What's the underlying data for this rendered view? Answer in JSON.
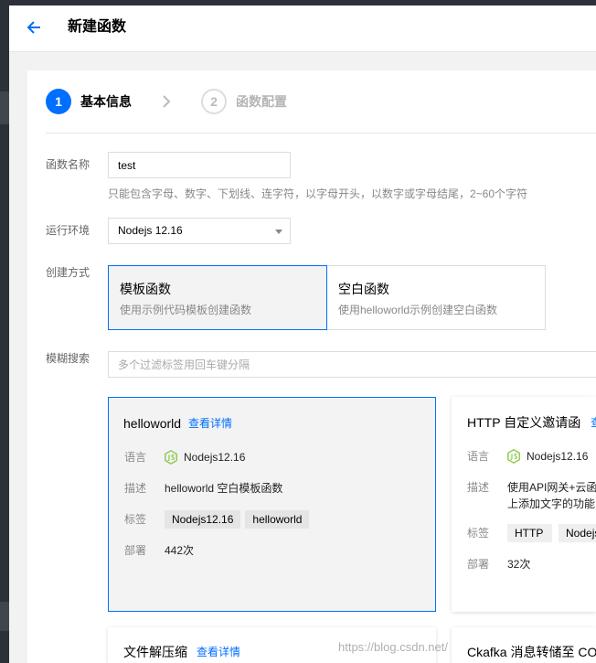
{
  "header": {
    "title": "新建函数"
  },
  "icons": {
    "back": "arrow-left-icon",
    "step_separator": "chevron-right-icon",
    "select_caret": "caret-down-icon",
    "language": "nodejs-icon"
  },
  "colors": {
    "accent": "#006eff",
    "nodejs_green": "#8cc84b",
    "sidebar": "#2c3038"
  },
  "steps": [
    {
      "number": "1",
      "label": "基本信息",
      "active": true
    },
    {
      "number": "2",
      "label": "函数配置",
      "active": false
    }
  ],
  "form": {
    "name": {
      "label": "函数名称",
      "value": "test",
      "help": "只能包含字母、数字、下划线、连字符，以字母开头，以数字或字母结尾，2~60个字符"
    },
    "runtime": {
      "label": "运行环境",
      "value": "Nodejs 12.16"
    },
    "create_mode": {
      "label": "创建方式",
      "options": [
        {
          "title": "模板函数",
          "desc": "使用示例代码模板创建函数",
          "selected": true
        },
        {
          "title": "空白函数",
          "desc": "使用helloworld示例创建空白函数",
          "selected": false
        }
      ]
    },
    "search": {
      "label": "模糊搜索",
      "placeholder": "多个过滤标签用回车键分隔"
    }
  },
  "templates": {
    "field_labels": {
      "language": "语言",
      "description": "描述",
      "tags": "标签",
      "deploys": "部署"
    },
    "cards": [
      {
        "title": "helloworld",
        "detail_link": "查看详情",
        "language": "Nodejs12.16",
        "description_lines": [
          "helloworld 空白模板函数"
        ],
        "tags": [
          "Nodejs12.16",
          "helloworld"
        ],
        "deploys": "442次",
        "selected": true
      },
      {
        "title": "HTTP 自定义邀请函",
        "detail_link": "查",
        "language": "Nodejs12.16",
        "description_lines": [
          "使用API网关+云函",
          "上添加文字的功能"
        ],
        "tags": [
          "HTTP",
          "Nodejs"
        ],
        "deploys": "32次",
        "selected": false
      },
      {
        "title": "文件解压缩",
        "detail_link": "查看详情"
      },
      {
        "title": "Ckafka 消息转储至 CO"
      }
    ]
  },
  "watermark": "https://blog.csdn.net/"
}
